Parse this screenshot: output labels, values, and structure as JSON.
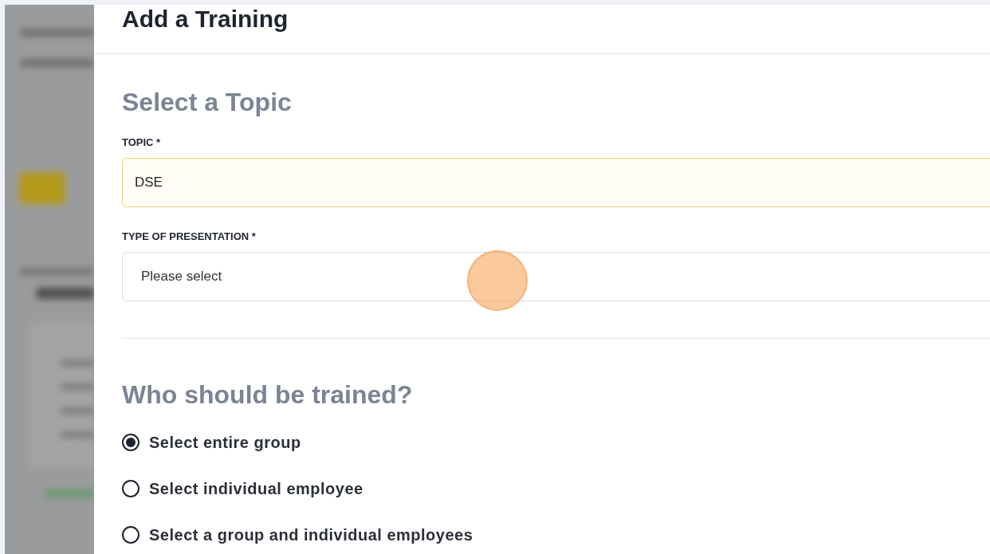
{
  "dialog": {
    "title": "Add a Training"
  },
  "topic_section": {
    "heading": "Select a Topic",
    "fields": [
      {
        "label": "TOPIC *",
        "value": "DSE",
        "focused": true
      },
      {
        "label": "TYPE OF PRESENTATION *",
        "placeholder": "Please select",
        "focused": false
      }
    ]
  },
  "trainees_section": {
    "heading": "Who should be trained?",
    "options": [
      {
        "label": "Select entire group",
        "selected": true
      },
      {
        "label": "Select individual employee",
        "selected": false
      },
      {
        "label": "Select a group and individual employees",
        "selected": false
      }
    ]
  }
}
